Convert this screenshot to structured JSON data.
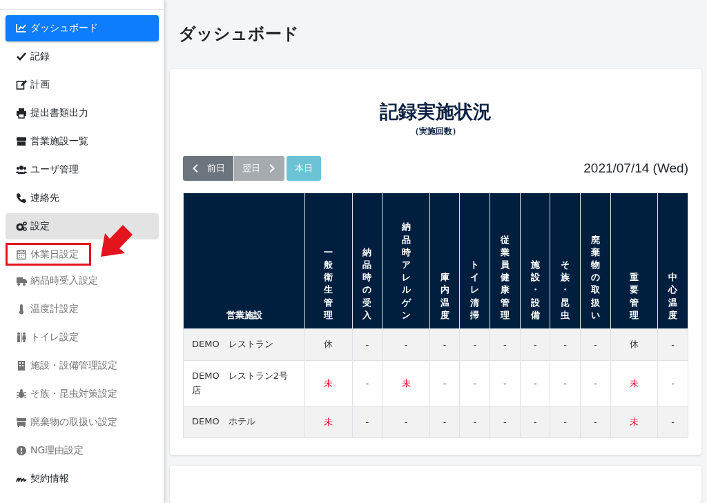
{
  "sidebar": {
    "items": [
      {
        "label": "ダッシュボード",
        "kind": "menu",
        "selected": true,
        "expanded": false,
        "boxed": false
      },
      {
        "label": "記録",
        "kind": "menu",
        "selected": false,
        "expanded": false,
        "boxed": false
      },
      {
        "label": "計画",
        "kind": "menu",
        "selected": false,
        "expanded": false,
        "boxed": false
      },
      {
        "label": "提出書類出力",
        "kind": "menu",
        "selected": false,
        "expanded": false,
        "boxed": false
      },
      {
        "label": "営業施設一覧",
        "kind": "menu",
        "selected": false,
        "expanded": false,
        "boxed": false
      },
      {
        "label": "ユーザ管理",
        "kind": "menu",
        "selected": false,
        "expanded": false,
        "boxed": false
      },
      {
        "label": "連絡先",
        "kind": "menu",
        "selected": false,
        "expanded": false,
        "boxed": false
      },
      {
        "label": "設定",
        "kind": "menu",
        "selected": false,
        "expanded": true,
        "boxed": false
      },
      {
        "label": "休業日設定",
        "kind": "submenu",
        "selected": false,
        "expanded": false,
        "boxed": true
      },
      {
        "label": "納品時受入設定",
        "kind": "submenu",
        "selected": false,
        "expanded": false,
        "boxed": false
      },
      {
        "label": "温度計設定",
        "kind": "submenu",
        "selected": false,
        "expanded": false,
        "boxed": false
      },
      {
        "label": "トイレ設定",
        "kind": "submenu",
        "selected": false,
        "expanded": false,
        "boxed": false
      },
      {
        "label": "施設・設備管理設定",
        "kind": "submenu",
        "selected": false,
        "expanded": false,
        "boxed": false
      },
      {
        "label": "そ族・昆虫対策設定",
        "kind": "submenu",
        "selected": false,
        "expanded": false,
        "boxed": false
      },
      {
        "label": "廃棄物の取扱い設定",
        "kind": "submenu",
        "selected": false,
        "expanded": false,
        "boxed": false
      },
      {
        "label": "NG理由設定",
        "kind": "submenu",
        "selected": false,
        "expanded": false,
        "boxed": false
      },
      {
        "label": "契約情報",
        "kind": "menu",
        "selected": false,
        "expanded": false,
        "boxed": false
      }
    ]
  },
  "page_title": "ダッシュボード",
  "card": {
    "title": "記録実施状況",
    "subtitle": "（実施回数）",
    "buttons": [
      {
        "label": "前日",
        "disabled": false
      },
      {
        "label": "翌日",
        "disabled": true
      },
      {
        "label": "本日",
        "disabled": false
      }
    ],
    "date": "2021/07/14 (Wed)",
    "table": {
      "columns": [
        "営業施設",
        "一般衛生管理",
        "納品時の受入",
        "納品時アレルゲン",
        "庫内温度",
        "トイレ清掃",
        "従業員健康管理",
        "施設・設備",
        "そ族・昆虫",
        "廃棄物の取扱い",
        "重要管理",
        "中心温度"
      ],
      "rows": [
        {
          "cells": [
            {
              "text": "DEMO　レストラン",
              "kind": "facility"
            },
            {
              "text": "休",
              "kind": "normal"
            },
            {
              "text": "-",
              "kind": "normal"
            },
            {
              "text": "-",
              "kind": "normal"
            },
            {
              "text": "-",
              "kind": "normal"
            },
            {
              "text": "-",
              "kind": "normal"
            },
            {
              "text": "-",
              "kind": "normal"
            },
            {
              "text": "-",
              "kind": "normal"
            },
            {
              "text": "-",
              "kind": "normal"
            },
            {
              "text": "-",
              "kind": "normal"
            },
            {
              "text": "休",
              "kind": "normal"
            },
            {
              "text": "-",
              "kind": "normal"
            }
          ]
        },
        {
          "cells": [
            {
              "text": "DEMO　レストラン2号店",
              "kind": "facility"
            },
            {
              "text": "未",
              "kind": "alert"
            },
            {
              "text": "-",
              "kind": "normal"
            },
            {
              "text": "未",
              "kind": "alert"
            },
            {
              "text": "-",
              "kind": "normal"
            },
            {
              "text": "-",
              "kind": "normal"
            },
            {
              "text": "-",
              "kind": "normal"
            },
            {
              "text": "-",
              "kind": "normal"
            },
            {
              "text": "-",
              "kind": "normal"
            },
            {
              "text": "-",
              "kind": "normal"
            },
            {
              "text": "未",
              "kind": "alert"
            },
            {
              "text": "-",
              "kind": "normal"
            }
          ]
        },
        {
          "cells": [
            {
              "text": "DEMO　ホテル",
              "kind": "facility"
            },
            {
              "text": "未",
              "kind": "alert"
            },
            {
              "text": "-",
              "kind": "normal"
            },
            {
              "text": "-",
              "kind": "normal"
            },
            {
              "text": "-",
              "kind": "normal"
            },
            {
              "text": "-",
              "kind": "normal"
            },
            {
              "text": "-",
              "kind": "normal"
            },
            {
              "text": "-",
              "kind": "normal"
            },
            {
              "text": "-",
              "kind": "normal"
            },
            {
              "text": "-",
              "kind": "normal"
            },
            {
              "text": "未",
              "kind": "alert"
            },
            {
              "text": "-",
              "kind": "normal"
            }
          ]
        }
      ]
    }
  }
}
